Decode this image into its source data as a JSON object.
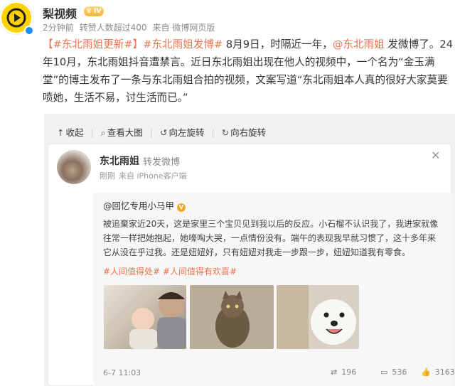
{
  "account": {
    "name": "梨视频",
    "level": "IV",
    "meta": [
      "2分钟前",
      "转赞人数超过400",
      "来自 微博网页版"
    ]
  },
  "post": {
    "tag1": "【#东北雨姐更新#】",
    "tag2": "#东北雨姐发博#",
    "text1": " 8月9日，时隔近一年，",
    "mention": "@东北雨姐",
    "text2": " 发微博了。24年10月，东北雨姐抖音遭禁言。近日东北雨姐出现在他人的视频中，一个名为“金玉满堂”的博主发布了一条与东北雨姐合拍的视频，文案写道“东北雨姐本人真的很好大家莫要喷她，生活不易，讨生活而已。”"
  },
  "toolbar": {
    "collapse": "收起",
    "view_large": "查看大图",
    "rotate_left": "向左旋转",
    "rotate_right": "向右旋转"
  },
  "repost": {
    "name": "东北雨姐",
    "action": "转发微博",
    "time": "刚刚",
    "source": "来自 iPhone客户端",
    "original": {
      "author": "@回忆专用小马甲",
      "text": "被追棄家近20天，这是家里三个宝贝见到我以后的反应。小石榴不认识我了，我进家就像往常一样把她抱起，她嚎啕大哭，一点情份没有。端午的表现我早就习惯了，这十多年来它从没在乎过我。还是妞妞好，只有妞妞对我走一步跟一步，妞妞知道我有零食。",
      "tags": "#人间值得处# #人间值得有欢喜#",
      "timestamp": "6-7 11:03",
      "reposts": "196",
      "comments": "536",
      "likes": "3163"
    }
  },
  "icons": [
    "verified-icon",
    "close-icon",
    "repost-icon",
    "comment-icon",
    "like-icon",
    "magnify-icon",
    "rotate-left-icon",
    "rotate-right-icon"
  ],
  "colors": {
    "accent": "#eb7350",
    "verified": "#1e8cf0",
    "brand": "#FFD200"
  }
}
